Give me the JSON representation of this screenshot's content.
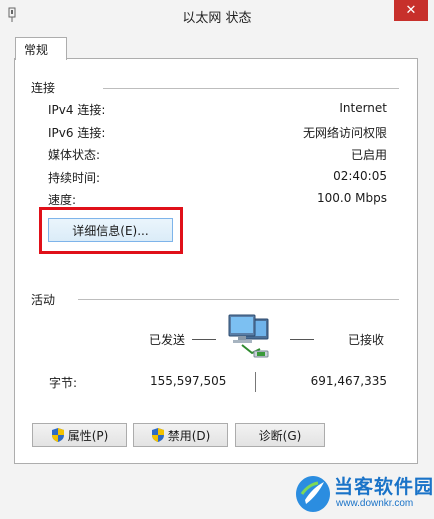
{
  "window": {
    "title": "以太网 状态",
    "close_glyph": "✕"
  },
  "tabs": [
    {
      "label": "常规",
      "active": true
    }
  ],
  "connection": {
    "title": "连接",
    "rows": [
      {
        "label": "IPv4 连接:",
        "value": "Internet"
      },
      {
        "label": "IPv6 连接:",
        "value": "无网络访问权限"
      },
      {
        "label": "媒体状态:",
        "value": "已启用"
      },
      {
        "label": "持续时间:",
        "value": "02:40:05"
      },
      {
        "label": "速度:",
        "value": "100.0 Mbps"
      }
    ],
    "details_button": "详细信息(E)..."
  },
  "activity": {
    "title": "活动",
    "sent_label": "已发送",
    "received_label": "已接收",
    "bytes_label": "字节:",
    "bytes_sent": "155,597,505",
    "bytes_received": "691,467,335",
    "icon": "network-computers-icon"
  },
  "buttons": {
    "properties": "属性(P)",
    "disable": "禁用(D)",
    "diagnose": "诊断(G)"
  },
  "watermark": {
    "title": "当客软件园",
    "url": "www.downkr.com"
  },
  "colors": {
    "highlight_box": "#e01019",
    "close_button": "#c7302b",
    "watermark_text": "#1a73c8"
  }
}
